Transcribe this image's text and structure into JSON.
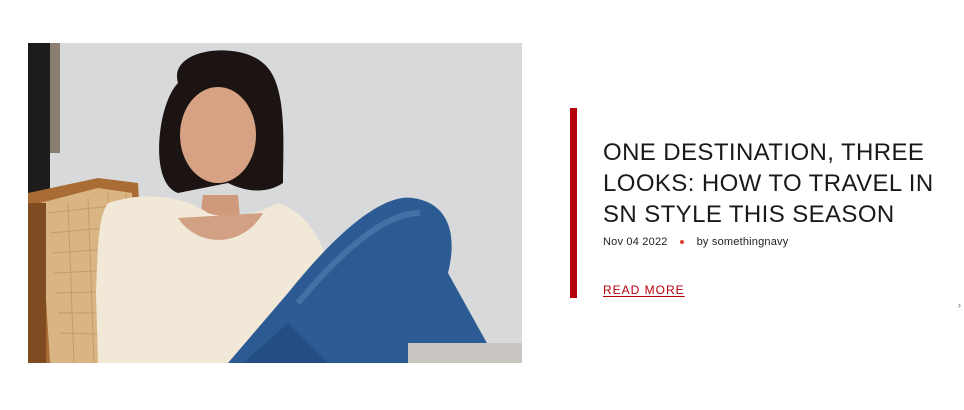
{
  "article": {
    "image_alt": "Model with dark hair wearing a cream blouse and blue jeans, seated in a cane chair",
    "title": "ONE DESTINATION, THREE LOOKS: HOW TO TRAVEL IN SN STYLE THIS SEASON",
    "date": "Nov 04 2022",
    "author": "by somethingnavy",
    "read_more_label": "READ MORE"
  },
  "colors": {
    "accent": "#b5000b",
    "dot": "#d9402f",
    "text": "#1a1a1a"
  },
  "edge_glyph": "›"
}
